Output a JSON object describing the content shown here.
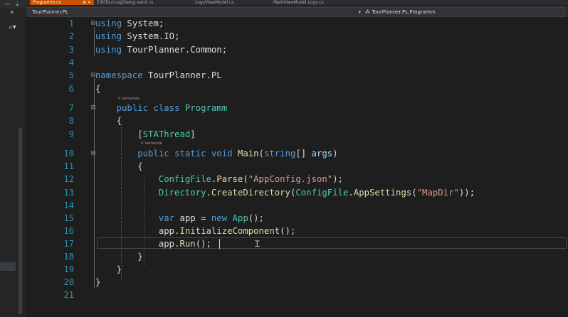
{
  "tabs": [
    {
      "label": "Programm.cs",
      "active": true,
      "pinned": true
    },
    {
      "label": "EditTourLogDialog.xaml.cs",
      "active": false
    },
    {
      "label": "LogsViewModel.cs",
      "active": false
    },
    {
      "label": "MainViewModel.Logs.cs",
      "active": false
    }
  ],
  "navbar": {
    "project": "TourPlanner.PL",
    "type_member": "TourPlanner.PL.Programm"
  },
  "codelens": {
    "class_refs": "0 Verweise",
    "method_refs": "0 Verweise"
  },
  "code_lines": [
    {
      "n": "1",
      "text": "using System;"
    },
    {
      "n": "2",
      "text": "using System.IO;"
    },
    {
      "n": "3",
      "text": "using TourPlanner.Common;"
    },
    {
      "n": "4",
      "text": ""
    },
    {
      "n": "5",
      "text": "namespace TourPlanner.PL"
    },
    {
      "n": "6",
      "text": "{"
    },
    {
      "n": "7",
      "text": "    public class Programm"
    },
    {
      "n": "8",
      "text": "    {"
    },
    {
      "n": "9",
      "text": "        [STAThread]"
    },
    {
      "n": "10",
      "text": "        public static void Main(string[] args)"
    },
    {
      "n": "11",
      "text": "        {"
    },
    {
      "n": "12",
      "text": "            ConfigFile.Parse(\"AppConfig.json\");"
    },
    {
      "n": "13",
      "text": "            Directory.CreateDirectory(ConfigFile.AppSettings(\"MapDir\"));"
    },
    {
      "n": "14",
      "text": ""
    },
    {
      "n": "15",
      "text": "            var app = new App();"
    },
    {
      "n": "16",
      "text": "            app.InitializeComponent();"
    },
    {
      "n": "17",
      "text": "            app.Run();"
    },
    {
      "n": "18",
      "text": "        }"
    },
    {
      "n": "19",
      "text": "    }"
    },
    {
      "n": "20",
      "text": "}"
    },
    {
      "n": "21",
      "text": ""
    }
  ],
  "colors": {
    "keyword": "#569cd6",
    "type": "#4ec9b0",
    "string": "#d69d85",
    "method": "#dcdcaa",
    "parameter": "#9cdcfe",
    "line_number": "#2b91af",
    "active_tab": "#ca5100",
    "background": "#1e1e1e"
  },
  "icons": [
    "search-icon",
    "pin-icon",
    "close-icon",
    "dropdown-icon",
    "collapse-icon"
  ]
}
